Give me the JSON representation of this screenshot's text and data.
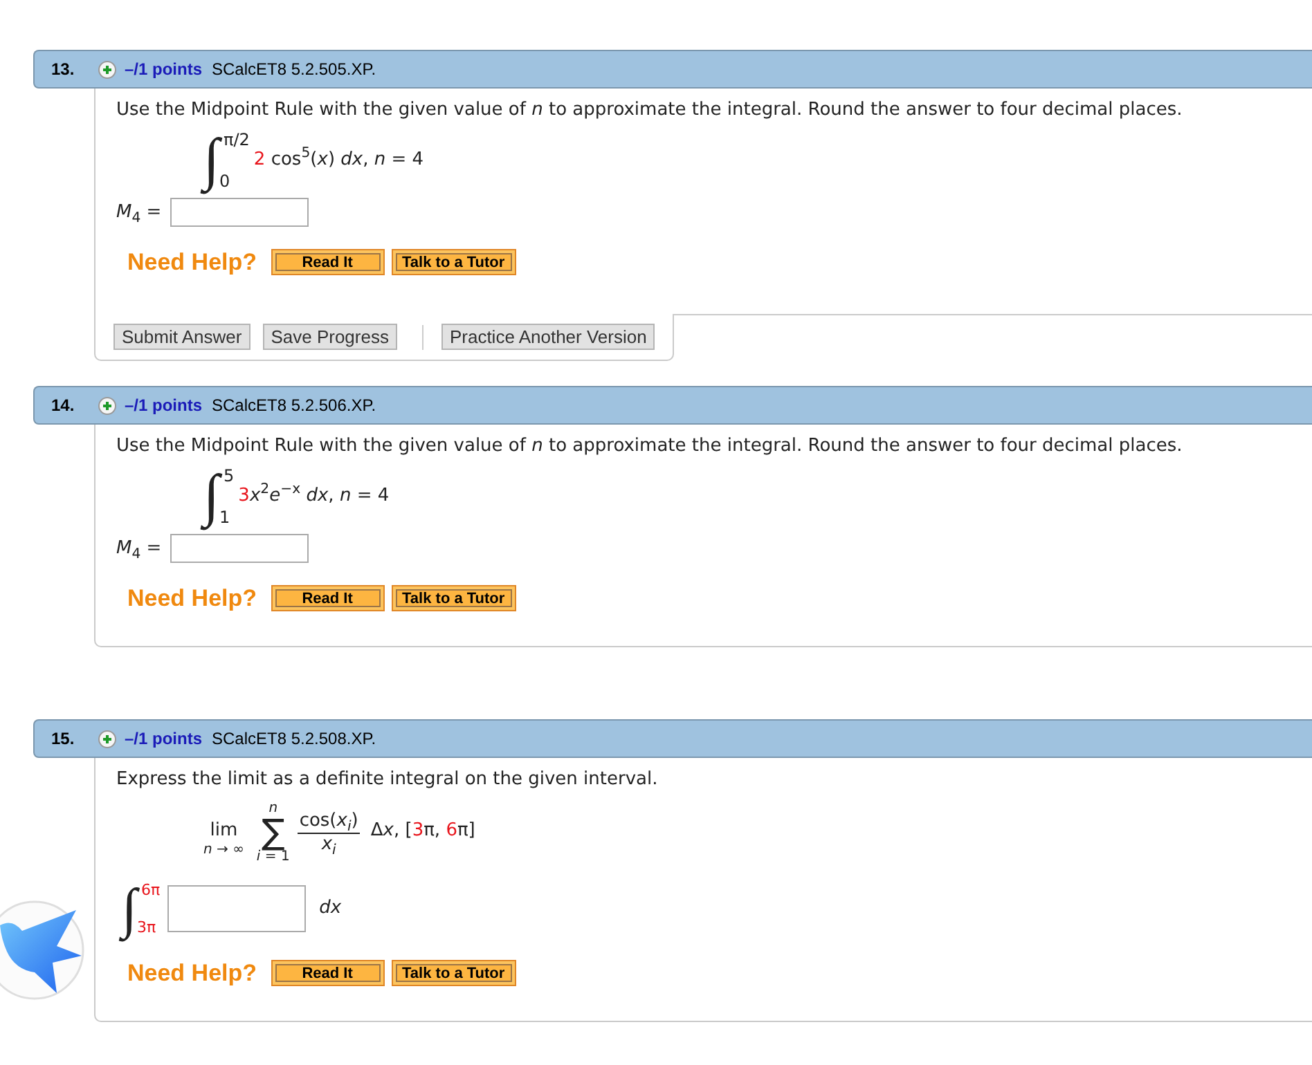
{
  "problems": [
    {
      "number": "13.",
      "points": "–/1 points",
      "code": "SCalcET8 5.2.505.XP.",
      "prompt": "Use the Midpoint Rule with the given value of *n* to approximate the integral. Round the answer to four decimal places.",
      "formula": {
        "kind": "integral",
        "sign": "∫",
        "upper": {
          "text": "π/2",
          "highlighted": false
        },
        "lower": {
          "text": "0",
          "highlighted": false
        },
        "integrand": [
          {
            "text": "2",
            "highlighted": true
          },
          {
            "text": " cos$^{5}$(*x*) *dx*, *n* = 4",
            "highlighted": false
          }
        ]
      },
      "answer": {
        "kind": "labeled",
        "label": "*M*$_{4}$ ="
      },
      "help": {
        "label": "Need Help?",
        "buttons": [
          "Read It",
          "Talk to a Tutor"
        ]
      },
      "actions": [
        [
          "Submit Answer",
          "Save Progress"
        ],
        [
          "Practice Another Version"
        ]
      ]
    },
    {
      "number": "14.",
      "points": "–/1 points",
      "code": "SCalcET8 5.2.506.XP.",
      "prompt": "Use the Midpoint Rule with the given value of *n* to approximate the integral. Round the answer to four decimal places.",
      "formula": {
        "kind": "integral",
        "sign": "∫",
        "upper": {
          "text": "5",
          "highlighted": false
        },
        "lower": {
          "text": "1",
          "highlighted": false
        },
        "integrand": [
          {
            "text": "3",
            "highlighted": true
          },
          {
            "text": "*x*$^{2}$*e*$^{−x}$ *dx*, *n* = 4",
            "highlighted": false
          }
        ]
      },
      "answer": {
        "kind": "labeled",
        "label": "*M*$_{4}$ ="
      },
      "help": {
        "label": "Need Help?",
        "buttons": [
          "Read It",
          "Talk to a Tutor"
        ]
      }
    },
    {
      "number": "15.",
      "points": "–/1 points",
      "code": "SCalcET8 5.2.508.XP.",
      "prompt": "Express the limit as a definite integral on the given interval.",
      "formula": {
        "kind": "limit_sum",
        "limit": "lim",
        "limit_sub": "*n* → ∞",
        "sigma": "∑",
        "sigma_upper": "n",
        "sigma_lower": "*i* = 1",
        "numerator": "cos(*x*$_{i}$)",
        "denominator": "*x*$_{i}$",
        "tail": [
          {
            "text": "Δ",
            "highlighted": false
          },
          {
            "text": "*x*, [",
            "highlighted": false
          },
          {
            "text": "3",
            "highlighted": true
          },
          {
            "text": "π, ",
            "highlighted": false
          },
          {
            "text": "6",
            "highlighted": true
          },
          {
            "text": "π]",
            "highlighted": false
          }
        ]
      },
      "answer": {
        "kind": "integral",
        "sign": "∫",
        "upper": {
          "text": "6π",
          "highlighted": true
        },
        "lower": {
          "text": "3π",
          "highlighted": true
        },
        "suffix": "dx"
      },
      "help": {
        "label": "Need Help?",
        "buttons": [
          "Read It",
          "Talk to a Tutor"
        ]
      }
    }
  ]
}
